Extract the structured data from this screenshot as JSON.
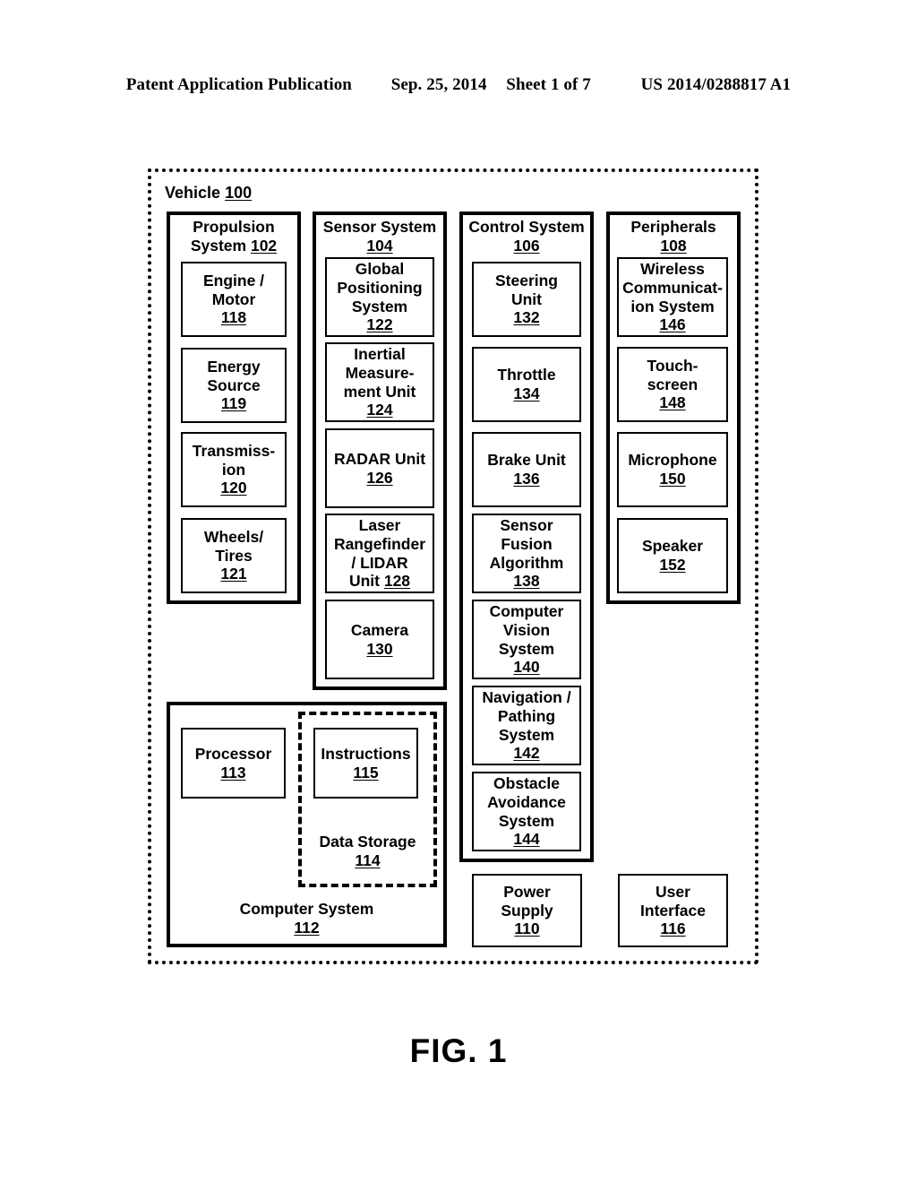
{
  "header": {
    "publication": "Patent Application Publication",
    "date": "Sep. 25, 2014",
    "sheet": "Sheet 1 of 7",
    "docnum": "US 2014/0288817 A1"
  },
  "figure": {
    "caption": "FIG. 1",
    "vehicle_label": "Vehicle",
    "vehicle_ref": "100"
  },
  "groups": {
    "propulsion": {
      "title_line1": "Propulsion",
      "title_line2": "System",
      "ref": "102",
      "items": [
        {
          "lines": [
            "Engine /",
            "Motor"
          ],
          "ref": "118"
        },
        {
          "lines": [
            "Energy",
            "Source"
          ],
          "ref": "119"
        },
        {
          "lines": [
            "Transmiss-",
            "ion"
          ],
          "ref": "120"
        },
        {
          "lines": [
            "Wheels/",
            "Tires"
          ],
          "ref": "121"
        }
      ]
    },
    "sensor": {
      "title_line1": "Sensor System",
      "ref": "104",
      "items": [
        {
          "lines": [
            "Global",
            "Positioning",
            "System"
          ],
          "ref": "122"
        },
        {
          "lines": [
            "Inertial",
            "Measure-",
            "ment Unit"
          ],
          "ref": "124"
        },
        {
          "lines": [
            "RADAR Unit"
          ],
          "ref": "126"
        },
        {
          "lines": [
            "Laser",
            "Rangefinder",
            "/ LIDAR",
            "Unit "
          ],
          "ref": "128",
          "inline_ref": true
        },
        {
          "lines": [
            "Camera"
          ],
          "ref": "130"
        }
      ]
    },
    "control": {
      "title_line1": "Control System",
      "ref": "106",
      "items": [
        {
          "lines": [
            "Steering",
            "Unit"
          ],
          "ref": "132"
        },
        {
          "lines": [
            "Throttle"
          ],
          "ref": "134"
        },
        {
          "lines": [
            "Brake Unit"
          ],
          "ref": "136"
        },
        {
          "lines": [
            "Sensor",
            "Fusion",
            "Algorithm"
          ],
          "ref": "138"
        },
        {
          "lines": [
            "Computer",
            "Vision",
            "System"
          ],
          "ref": "140"
        },
        {
          "lines": [
            "Navigation /",
            "Pathing",
            "System"
          ],
          "ref": "142"
        },
        {
          "lines": [
            "Obstacle",
            "Avoidance",
            "System"
          ],
          "ref": "144"
        }
      ]
    },
    "peripherals": {
      "title_line1": "Peripherals",
      "ref": "108",
      "items": [
        {
          "lines": [
            "Wireless",
            "Communicat-",
            "ion System"
          ],
          "ref": "146"
        },
        {
          "lines": [
            "Touch-",
            "screen"
          ],
          "ref": "148"
        },
        {
          "lines": [
            "Microphone"
          ],
          "ref": "150"
        },
        {
          "lines": [
            "Speaker"
          ],
          "ref": "152"
        }
      ]
    },
    "computer_system": {
      "title_line1": "Computer System",
      "ref": "112",
      "processor": {
        "lines": [
          "Processor"
        ],
        "ref": "113"
      },
      "instructions": {
        "lines": [
          "Instructions"
        ],
        "ref": "115"
      },
      "data_storage": {
        "lines": [
          "Data Storage"
        ],
        "ref": "114"
      }
    }
  },
  "standalone": [
    {
      "lines": [
        "Power",
        "Supply"
      ],
      "ref": "110"
    },
    {
      "lines": [
        "User",
        "Interface"
      ],
      "ref": "116"
    }
  ]
}
